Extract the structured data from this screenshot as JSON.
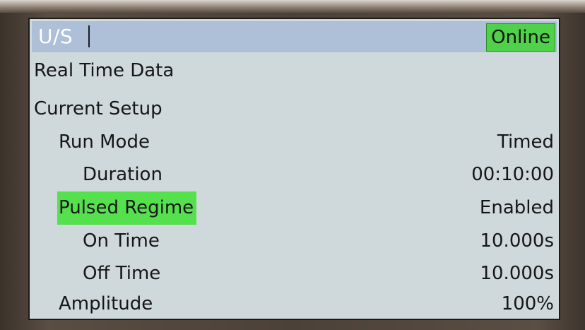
{
  "header": {
    "title": "U/S",
    "status": "Online"
  },
  "menu": {
    "items": [
      {
        "label": "Real Time Data",
        "value": ""
      },
      {
        "label": "Current Setup",
        "value": ""
      },
      {
        "label": "Run Mode",
        "value": "Timed"
      },
      {
        "label": "Duration",
        "value": "00:10:00"
      },
      {
        "label": "Pulsed Regime",
        "value": "Enabled"
      },
      {
        "label": "On Time",
        "value": "10.000s"
      },
      {
        "label": "Off Time",
        "value": "10.000s"
      },
      {
        "label": "Amplitude",
        "value": "100%"
      }
    ],
    "selected_label": "Pulsed Regime"
  },
  "colors": {
    "title_bar": "#aebfd8",
    "online_badge": "#4fd14a",
    "selection_highlight": "#55e04e",
    "screen_background": "#cfd8db"
  }
}
